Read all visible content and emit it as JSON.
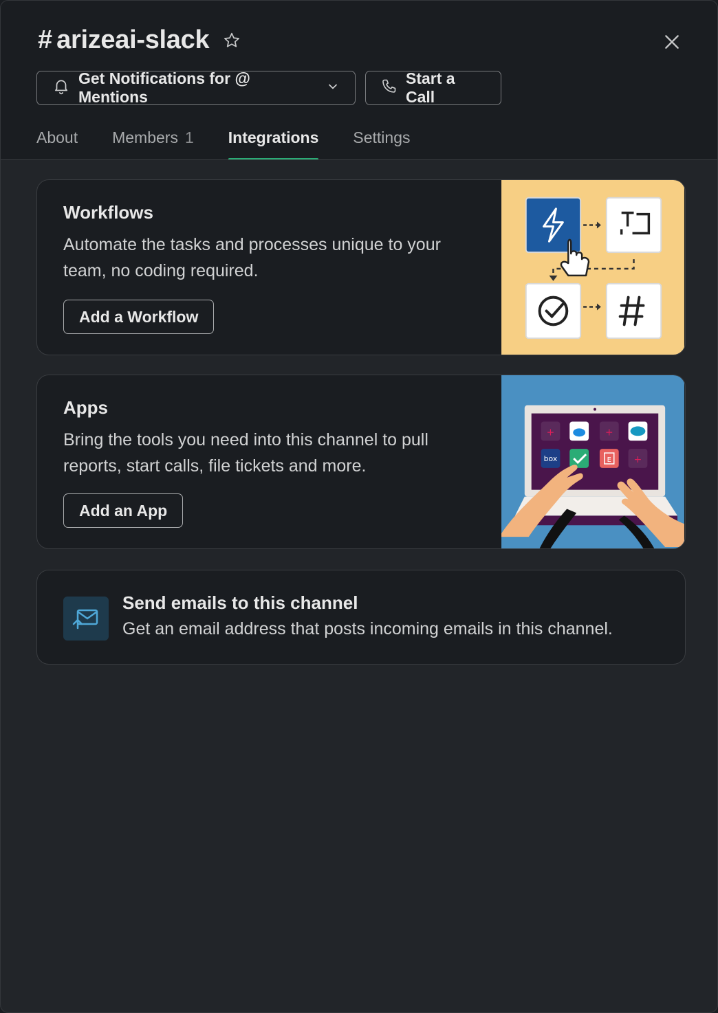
{
  "header": {
    "hash": "#",
    "channel_name": "arizeai-slack",
    "notifications_label": "Get Notifications for @ Mentions",
    "call_label": "Start a Call"
  },
  "tabs": [
    {
      "label": "About"
    },
    {
      "label": "Members",
      "count": "1"
    },
    {
      "label": "Integrations",
      "active": true
    },
    {
      "label": "Settings"
    }
  ],
  "workflows": {
    "title": "Workflows",
    "description": "Automate the tasks and processes unique to your team, no coding required.",
    "button": "Add a Workflow"
  },
  "apps": {
    "title": "Apps",
    "description": "Bring the tools you need into this channel to pull reports, start calls, file tickets and more.",
    "button": "Add an App",
    "illustration_tile_label": "box",
    "illustration_tile_letter": "E"
  },
  "email": {
    "title": "Send emails to this channel",
    "description": "Get an email address that posts incoming emails in this channel."
  },
  "colors": {
    "accent": "#2bac76",
    "workflow_bg": "#f7cf84",
    "apps_bg": "#4a90c2"
  },
  "icons": {
    "star": "star-icon",
    "close": "close-icon",
    "bell": "bell-icon",
    "chevron": "chevron-down-icon",
    "phone": "phone-icon",
    "email": "email-forward-icon"
  }
}
